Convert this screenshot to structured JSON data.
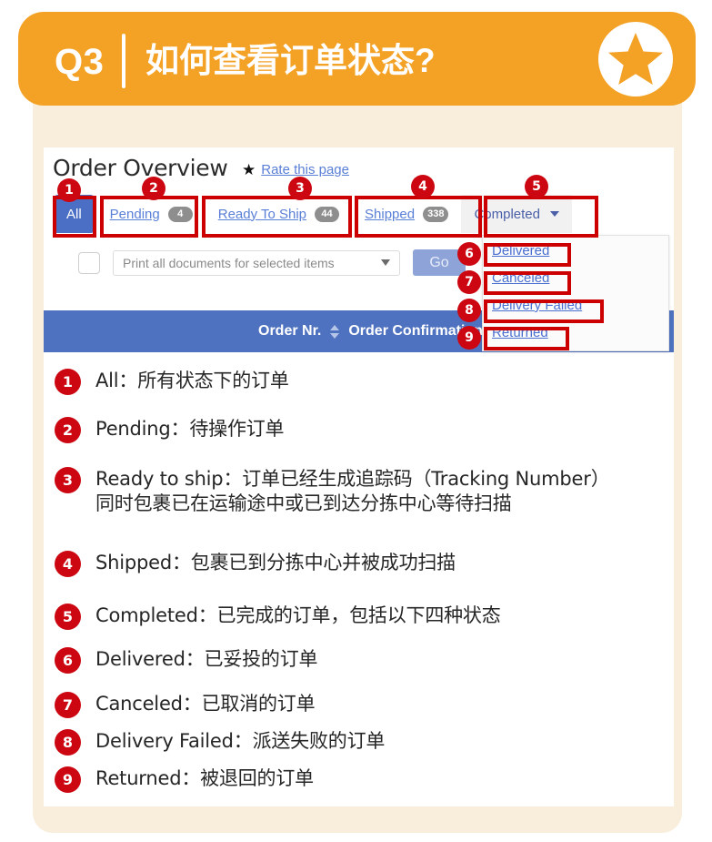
{
  "banner": {
    "question_number": "Q3",
    "title": "如何查看订单状态?",
    "star_icon": "star-icon",
    "color": "#f4a226"
  },
  "screenshot": {
    "page_title": "Order Overview",
    "rate_link": "Rate this page",
    "rate_star_icon": "star-icon",
    "tabs": [
      {
        "label": "All",
        "count": "",
        "active": true,
        "has_caret": false
      },
      {
        "label": "Pending",
        "count": "4",
        "active": false,
        "has_caret": false
      },
      {
        "label": "Ready To Ship",
        "count": "44",
        "active": false,
        "has_caret": false
      },
      {
        "label": "Shipped",
        "count": "338",
        "active": false,
        "has_caret": false
      },
      {
        "label": "Completed",
        "count": "",
        "active": false,
        "has_caret": true
      }
    ],
    "toolbar": {
      "select_value": "Print all documents for selected items",
      "go_label": "Go",
      "checkbox_checked": false
    },
    "table_headers": {
      "order_nr": "Order Nr.",
      "order_confirmation_date": "Order Confirmation Date"
    },
    "dropdown_items": [
      "Delivered",
      "Canceled",
      "Delivery Failed",
      "Returned"
    ],
    "annotation_markers": [
      "1",
      "2",
      "3",
      "4",
      "5",
      "6",
      "7",
      "8",
      "9"
    ],
    "accent_blue": "#4a6fc4",
    "header_blue": "#4f72c0",
    "annotation_red": "#cc0000"
  },
  "legend": {
    "items": [
      {
        "num": "1",
        "text": "All：所有状态下的订单"
      },
      {
        "num": "2",
        "text": "Pending：待操作订单"
      },
      {
        "num": "3",
        "text": "Ready to ship：订单已经生成追踪码（Tracking Number）\n同时包裹已在运输途中或已到达分拣中心等待扫描"
      },
      {
        "num": "4",
        "text": "Shipped：包裹已到分拣中心并被成功扫描"
      },
      {
        "num": "5",
        "text": "Completed：已完成的订单，包括以下四种状态"
      },
      {
        "num": "6",
        "text": "Delivered：已妥投的订单"
      },
      {
        "num": "7",
        "text": "Canceled：已取消的订单"
      },
      {
        "num": "8",
        "text": "Delivery Failed：派送失败的订单"
      },
      {
        "num": "9",
        "text": "Returned：被退回的订单"
      }
    ]
  }
}
